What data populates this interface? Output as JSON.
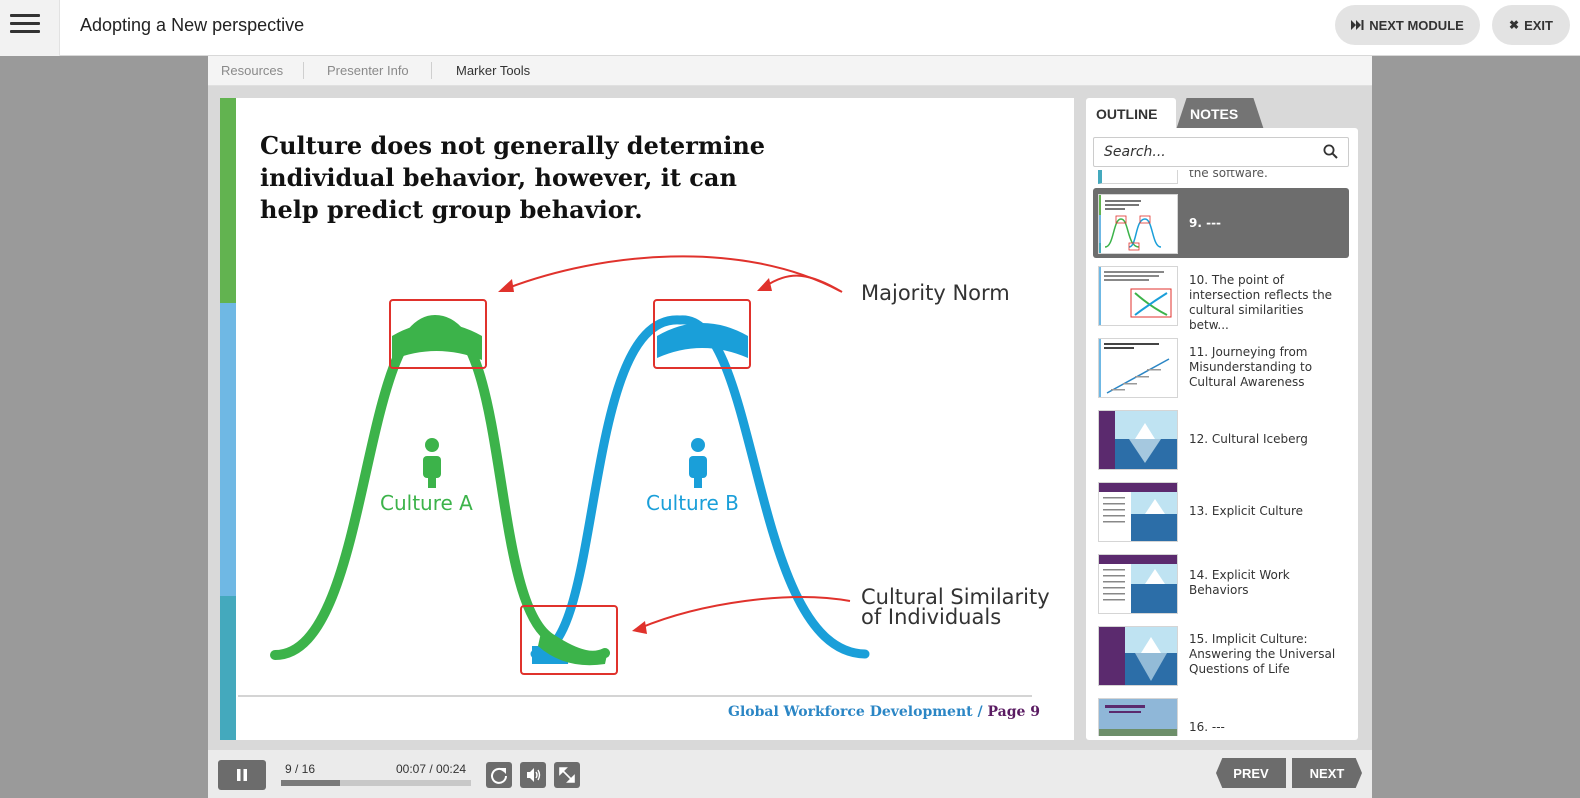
{
  "header": {
    "menu_icon": "hamburger-menu-icon",
    "course_title": "Adopting a New perspective",
    "next_module_label": "NEXT MODULE",
    "next_module_icon": "skip-forward-icon",
    "exit_label": "EXIT",
    "exit_icon": "close-icon"
  },
  "toolbar": {
    "items": [
      {
        "label": "Resources",
        "active": false
      },
      {
        "label": "Presenter Info",
        "active": false
      },
      {
        "label": "Marker Tools",
        "active": true
      }
    ]
  },
  "slide": {
    "title": "Culture does not generally determine individual behavior, however, it can help predict group behavior.",
    "label_majority": "Majority Norm",
    "label_similarity_line1": "Cultural Similarity",
    "label_similarity_line2": "of Individuals",
    "culture_a": "Culture A",
    "culture_b": "Culture B",
    "footer_brand": "Global Workforce Development / ",
    "footer_page": "Page 9",
    "colors": {
      "green": "#3cb34a",
      "blue": "#1a9fd9",
      "red": "#e0322c",
      "bar_green": "#62b350",
      "bar_lightblue": "#6fb8e4",
      "bar_teal": "#44a9bd",
      "footer_blue": "#2b86c5",
      "footer_page": "#5a1b62"
    }
  },
  "sidebar": {
    "tabs": [
      {
        "label": "OUTLINE",
        "active": true
      },
      {
        "label": "NOTES",
        "active": false
      }
    ],
    "search_placeholder": "Search...",
    "search_icon": "magnifier-icon",
    "partial_item_text": "the software.",
    "items": [
      {
        "label": "9. ---",
        "active": true
      },
      {
        "label": "10. The point of intersection reflects the cultural similarities betw..."
      },
      {
        "label": "11. Journeying from Misunderstanding to Cultural Awareness"
      },
      {
        "label": "12. Cultural Iceberg"
      },
      {
        "label": "13. Explicit Culture"
      },
      {
        "label": "14. Explicit Work Behaviors"
      },
      {
        "label": "15. Implicit Culture: Answering the Universal Questions of Life"
      },
      {
        "label": "16. ---"
      }
    ]
  },
  "controls": {
    "play_pause_icon": "pause-icon",
    "slide_counter": "9 / 16",
    "time": "00:07 / 00:24",
    "progress": 0.31,
    "replay_icon": "replay-icon",
    "volume_icon": "volume-icon",
    "fullscreen_icon": "fullscreen-icon",
    "prev_label": "PREV",
    "next_label": "NEXT"
  }
}
